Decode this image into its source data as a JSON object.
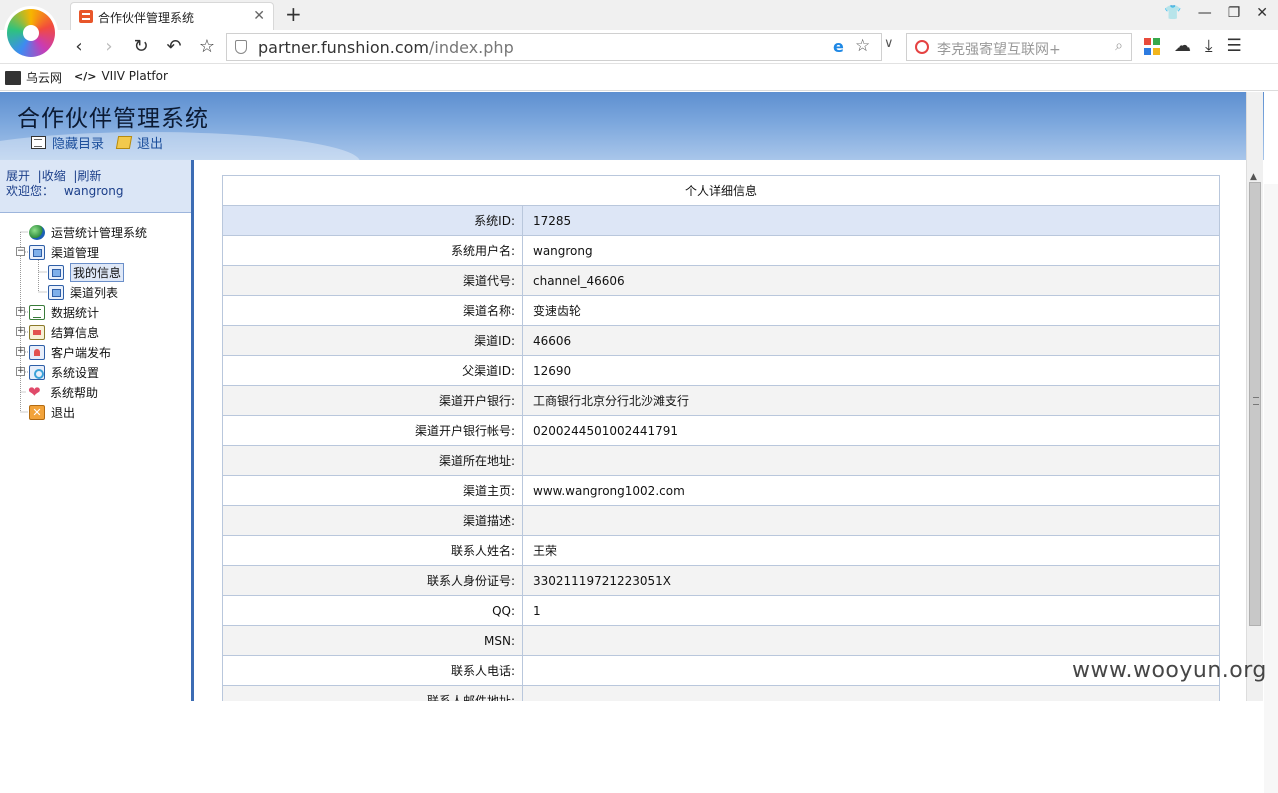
{
  "browser": {
    "tab_title": "合作伙伴管理系统",
    "url_host": "partner.funshion.com",
    "url_path": "/index.php",
    "search_placeholder": "李克强寄望互联网+",
    "bookmarks": [
      {
        "label": "乌云网"
      },
      {
        "label": "VIIV Platfor"
      }
    ]
  },
  "header": {
    "title": "合作伙伴管理系统",
    "hide_menu": "隐藏目录",
    "logout": "退出"
  },
  "sidebar": {
    "expand": "展开",
    "collapse": "收缩",
    "refresh": "刷新",
    "welcome_label": "欢迎您：",
    "username": "wangrong",
    "tree": [
      {
        "label": "运营统计管理系统",
        "icon": "globe-icon"
      },
      {
        "label": "渠道管理",
        "icon": "window-icon"
      },
      {
        "label": "我的信息",
        "icon": "window-icon",
        "selected": true
      },
      {
        "label": "渠道列表",
        "icon": "window-icon"
      },
      {
        "label": "数据统计",
        "icon": "doc-icon"
      },
      {
        "label": "结算信息",
        "icon": "calc-icon"
      },
      {
        "label": "客户端发布",
        "icon": "user-icon"
      },
      {
        "label": "系统设置",
        "icon": "gear-icon"
      },
      {
        "label": "系统帮助",
        "icon": "heart-icon"
      },
      {
        "label": "退出",
        "icon": "close-icon"
      }
    ]
  },
  "detail": {
    "caption": "个人详细信息",
    "rows": [
      {
        "label": "系统ID:",
        "value": "17285"
      },
      {
        "label": "系统用户名:",
        "value": "wangrong"
      },
      {
        "label": "渠道代号:",
        "value": "channel_46606"
      },
      {
        "label": "渠道名称:",
        "value": "变速齿轮"
      },
      {
        "label": "渠道ID:",
        "value": "46606"
      },
      {
        "label": "父渠道ID:",
        "value": "12690"
      },
      {
        "label": "渠道开户银行:",
        "value": "工商银行北京分行北沙滩支行"
      },
      {
        "label": "渠道开户银行帐号:",
        "value": "0200244501002441791"
      },
      {
        "label": "渠道所在地址:",
        "value": ""
      },
      {
        "label": "渠道主页:",
        "value": "www.wangrong1002.com"
      },
      {
        "label": "渠道描述:",
        "value": ""
      },
      {
        "label": "联系人姓名:",
        "value": "王荣"
      },
      {
        "label": "联系人身份证号:",
        "value": "33021119721223051X"
      },
      {
        "label": "QQ:",
        "value": "1"
      },
      {
        "label": "MSN:",
        "value": ""
      },
      {
        "label": "联系人电话:",
        "value": ""
      },
      {
        "label": "联系人邮件地址:",
        "value": ""
      }
    ]
  },
  "watermark": "www.wooyun.org"
}
